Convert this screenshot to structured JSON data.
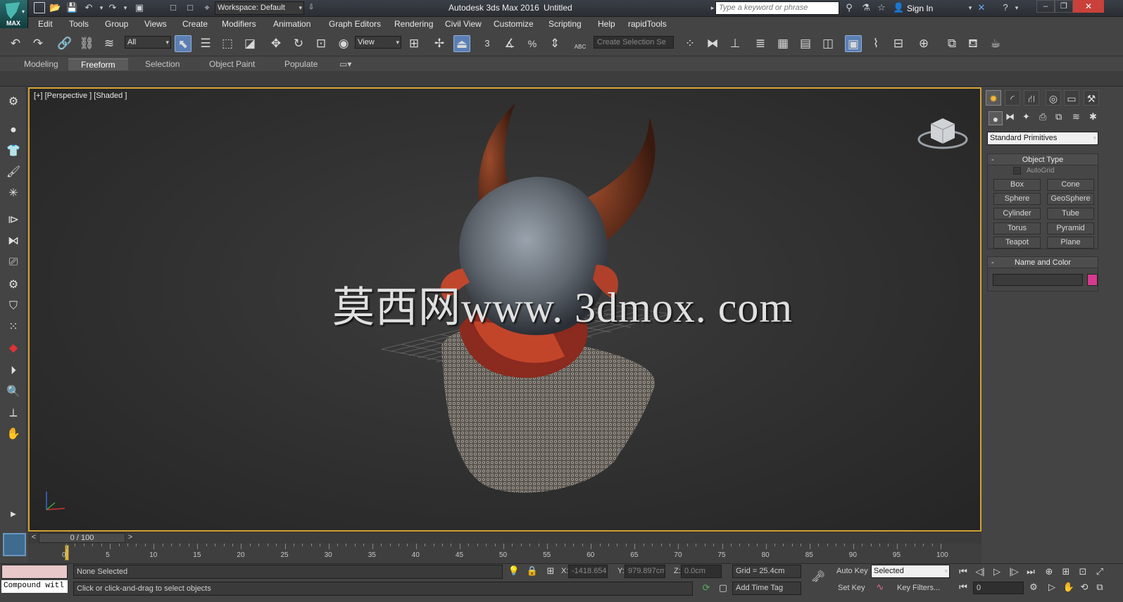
{
  "titlebar": {
    "workspace": "Workspace: Default",
    "app_title": "Autodesk 3ds Max 2016",
    "doc_title": "Untitled",
    "search_placeholder": "Type a keyword or phrase",
    "sign_in": "Sign In",
    "logo_text": "MAX"
  },
  "menu": [
    "Edit",
    "Tools",
    "Group",
    "Views",
    "Create",
    "Modifiers",
    "Animation",
    "Graph Editors",
    "Rendering",
    "Civil View",
    "Customize",
    "Scripting",
    "Help",
    "rapidTools"
  ],
  "toolbar": {
    "filter": "All",
    "ref_coord": "View",
    "selection_set_placeholder": "Create Selection Se",
    "snap_3": "3",
    "snap_pct": "%",
    "abc": "ABC"
  },
  "ribbon": {
    "tabs": [
      "Modeling",
      "Freeform",
      "Selection",
      "Object Paint",
      "Populate"
    ],
    "active": "Freeform"
  },
  "viewport": {
    "label": "[+] [Perspective ] [Shaded ]",
    "watermark": "莫西网www. 3dmox. com"
  },
  "command_panel": {
    "dropdown": "Standard Primitives",
    "object_type": {
      "title": "Object Type",
      "autogrid": "AutoGrid",
      "buttons": [
        "Box",
        "Cone",
        "Sphere",
        "GeoSphere",
        "Cylinder",
        "Tube",
        "Torus",
        "Pyramid",
        "Teapot",
        "Plane"
      ]
    },
    "name_color": {
      "title": "Name and Color",
      "swatch": "#d63a8f"
    },
    "rollout_toggle": "-"
  },
  "timeslider": {
    "frame": "0 / 100",
    "prev": "<",
    "next": ">"
  },
  "track": {
    "labels": [
      "0",
      "5",
      "10",
      "15",
      "20",
      "25",
      "30",
      "35",
      "40",
      "45",
      "50",
      "55",
      "60",
      "65",
      "70",
      "75",
      "80",
      "85",
      "90",
      "95",
      "100"
    ]
  },
  "status": {
    "script_listener": "Compound witl",
    "selection": "None Selected",
    "prompt": "Click or click-and-drag to select objects",
    "x_label": "X:",
    "x_value": "-1418.654",
    "y_label": "Y:",
    "y_value": "979.897cm",
    "z_label": "Z:",
    "z_value": "0.0cm",
    "grid": "Grid = 25.4cm",
    "add_time_tag": "Add Time Tag",
    "auto_key": "Auto Key",
    "set_key": "Set Key",
    "selected": "Selected",
    "key_filters": "Key Filters...",
    "frame_value": "0"
  },
  "colors": {
    "viewport_border": "#d3a233",
    "accent_blue": "#5b7fb4",
    "swatch": "#d63a8f"
  }
}
